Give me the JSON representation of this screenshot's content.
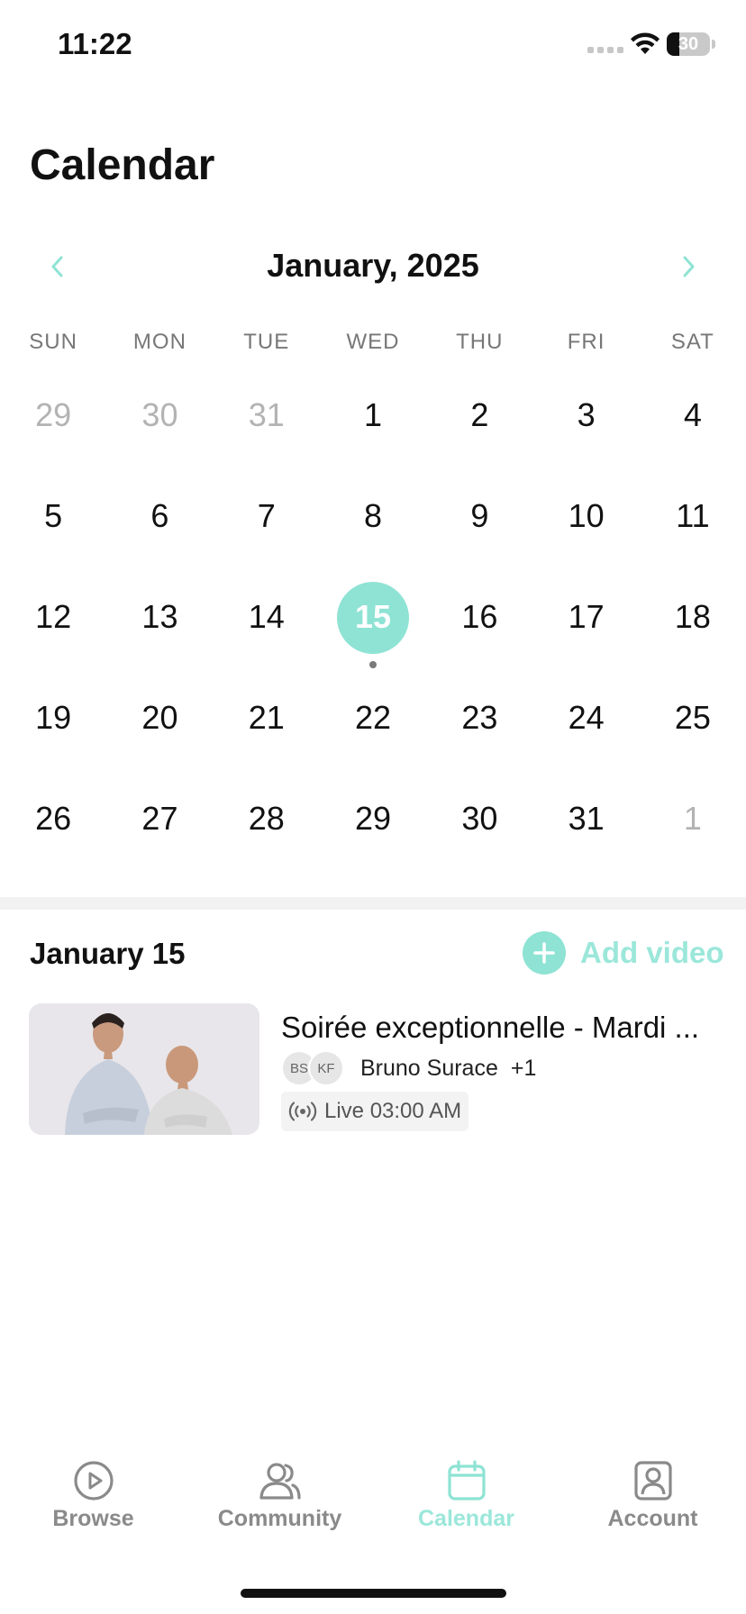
{
  "status_bar": {
    "time": "11:22",
    "battery_text": "30",
    "icons": [
      "signal-icon",
      "wifi-icon",
      "battery-icon"
    ]
  },
  "page": {
    "title": "Calendar"
  },
  "calendar": {
    "month_label": "January, 2025",
    "prev_icon": "chevron-left-icon",
    "next_icon": "chevron-right-icon",
    "weekdays": [
      "SUN",
      "MON",
      "TUE",
      "WED",
      "THU",
      "FRI",
      "SAT"
    ],
    "days": [
      {
        "label": "29",
        "muted": true
      },
      {
        "label": "30",
        "muted": true
      },
      {
        "label": "31",
        "muted": true
      },
      {
        "label": "1"
      },
      {
        "label": "2"
      },
      {
        "label": "3"
      },
      {
        "label": "4"
      },
      {
        "label": "5"
      },
      {
        "label": "6"
      },
      {
        "label": "7"
      },
      {
        "label": "8"
      },
      {
        "label": "9"
      },
      {
        "label": "10"
      },
      {
        "label": "11"
      },
      {
        "label": "12"
      },
      {
        "label": "13"
      },
      {
        "label": "14"
      },
      {
        "label": "15",
        "selected": true,
        "has_event": true
      },
      {
        "label": "16"
      },
      {
        "label": "17"
      },
      {
        "label": "18"
      },
      {
        "label": "19"
      },
      {
        "label": "20"
      },
      {
        "label": "21"
      },
      {
        "label": "22"
      },
      {
        "label": "23"
      },
      {
        "label": "24"
      },
      {
        "label": "25"
      },
      {
        "label": "26"
      },
      {
        "label": "27"
      },
      {
        "label": "28"
      },
      {
        "label": "29"
      },
      {
        "label": "30"
      },
      {
        "label": "31"
      },
      {
        "label": "1",
        "muted": true
      }
    ],
    "accent_color": "#8ee3d4"
  },
  "day_section": {
    "heading": "January 15",
    "add_label": "Add video",
    "add_icon": "plus-icon"
  },
  "event": {
    "title": "Soirée exceptionnelle - Mardi ...",
    "avatars": [
      "BS",
      "KF"
    ],
    "host_name": "Bruno Surace",
    "host_more": "+1",
    "live_text": "Live 03:00 AM",
    "live_icon": "broadcast-icon"
  },
  "tabs": [
    {
      "label": "Browse",
      "icon": "play-circle-icon",
      "active": false
    },
    {
      "label": "Community",
      "icon": "users-icon",
      "active": false
    },
    {
      "label": "Calendar",
      "icon": "calendar-icon",
      "active": true
    },
    {
      "label": "Account",
      "icon": "account-icon",
      "active": false
    }
  ]
}
